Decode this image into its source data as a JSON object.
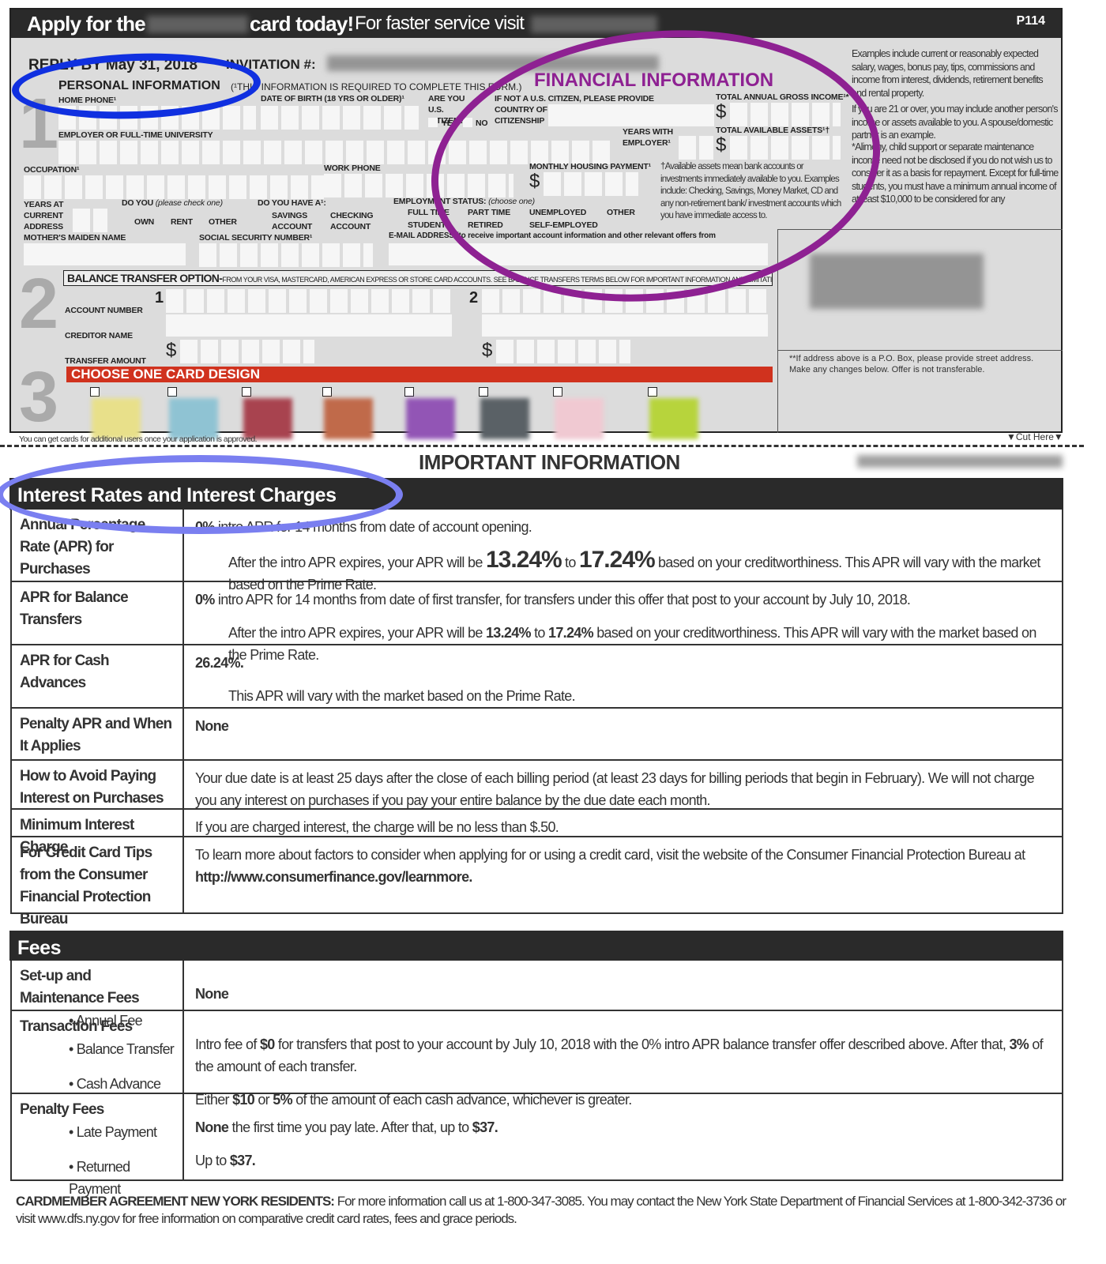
{
  "header": {
    "apply": "Apply for the",
    "card_today": "card today!",
    "faster": "For faster service visit",
    "code": "P114"
  },
  "top": {
    "reply_by": "REPLY BY May 31, 2018",
    "invitation": "INVITATION #:"
  },
  "section1": {
    "number": "1",
    "title": "PERSONAL INFORMATION",
    "title_note": "(¹THIS INFORMATION IS REQUIRED TO COMPLETE THIS FORM.)",
    "home_phone": "HOME PHONE¹",
    "dob": "DATE OF BIRTH (18 YRS OR OLDER)¹",
    "citizen": "ARE YOU U.S. CITIZEN?",
    "yes": "YES",
    "no": "NO",
    "not_citizen": "IF NOT A U.S. CITIZEN, PLEASE PROVIDE",
    "country": "COUNTRY OF CITIZENSHIP",
    "employer": "EMPLOYER OR FULL-TIME UNIVERSITY",
    "years_employer": "YEARS WITH EMPLOYER¹",
    "occupation": "OCCUPATION¹",
    "work_phone": "WORK PHONE",
    "housing": "MONTHLY HOUSING PAYMENT¹",
    "years_address": "YEARS AT CURRENT ADDRESS",
    "do_you": "DO YOU",
    "check_one": "(please check one)",
    "own": "OWN",
    "rent": "RENT",
    "other": "OTHER",
    "have_a": "DO YOU HAVE A¹:",
    "savings": "SAVINGS ACCOUNT",
    "checking": "CHECKING ACCOUNT",
    "employment": "EMPLOYMENT STATUS:",
    "choose_one": "(choose one)",
    "full_time": "FULL TIME",
    "part_time": "PART TIME",
    "unemployed": "UNEMPLOYED",
    "emp_other": "OTHER",
    "student": "STUDENT",
    "retired": "RETIRED",
    "self_employed": "SELF-EMPLOYED",
    "maiden": "MOTHER'S MAIDEN NAME",
    "ssn": "SOCIAL SECURITY NUMBER¹",
    "email": "E-MAIL ADDRESS (to receive important account information and other relevant offers from",
    "income": "TOTAL ANNUAL GROSS INCOME¹*",
    "assets": "TOTAL AVAILABLE ASSETS¹†",
    "financial_info": "FINANCIAL INFORMATION",
    "assets_note": "†Available assets mean bank accounts or investments immediately available to you. Examples include: Checking, Savings, Money Market, CD and any non-retirement bank/ investment accounts which you have immediate access to.",
    "income_note_1": "Examples include current or reasonably expected salary, wages, bonus pay, tips, commissions and income from interest, dividends, retirement benefits and rental property.",
    "income_note_2": "If you are 21 or over, you may include another person's income or assets available to you. A spouse/domestic partner is an example.",
    "income_note_3": "*Alimony, child support or separate maintenance income need not be disclosed if you do not wish us to consider it as a basis for repayment. Except for full-time students, you must have a minimum annual income of at least $10,000 to be considered for any"
  },
  "section2": {
    "number": "2",
    "title": "BALANCE TRANSFER OPTION-",
    "subtitle": "FROM YOUR VISA, MASTERCARD, AMERICAN EXPRESS OR STORE CARD ACCOUNTS. SEE BALANCE TRANSFERS TERMS BELOW FOR IMPORTANT INFORMATION AND LIMITATIONS.",
    "account_number": "ACCOUNT NUMBER",
    "creditor": "CREDITOR NAME",
    "amount": "TRANSFER AMOUNT",
    "one": "1",
    "two": "2",
    "dollar": "$"
  },
  "section3": {
    "number": "3",
    "title": "CHOOSE ONE CARD DESIGN",
    "swatches": [
      "#e8e08a",
      "#8fc3d3",
      "#a8434f",
      "#c06a4a",
      "#9255b5",
      "#5a6166",
      "#f0c9d2",
      "#b7d43c"
    ]
  },
  "address_note": "**If address above is a P.O. Box, please provide street address. Make any changes below. Offer is not transferable.",
  "additional_users": "You can get cards for additional users once your application is approved.",
  "cut_here": "▼Cut Here▼",
  "important": "IMPORTANT INFORMATION",
  "interest": {
    "title": "Interest Rates and Interest Charges",
    "rows": [
      {
        "label": [
          "Annual Percentage Rate (APR) for Purchases"
        ],
        "lines": [
          [
            {
              "b": "0%"
            },
            {
              "t": " intro APR for 14 months from date of account opening."
            }
          ],
          [
            {
              "t": "After the intro APR expires, your APR will be "
            },
            {
              "xl": "13.24%"
            },
            {
              "t": " to "
            },
            {
              "xl": "17.24%"
            },
            {
              "t": " based on your creditworthiness. This APR will vary with the market based on the Prime Rate."
            }
          ]
        ]
      },
      {
        "label": [
          "APR for Balance Transfers"
        ],
        "lines": [
          [
            {
              "b": "0%"
            },
            {
              "t": " intro APR for 14 months from date of first transfer, for transfers under this offer that post to your account by July 10, 2018."
            }
          ],
          [
            {
              "t": "After the intro APR expires, your APR will be "
            },
            {
              "b": "13.24%"
            },
            {
              "t": " to "
            },
            {
              "b": "17.24%"
            },
            {
              "t": " based on your creditworthiness. This APR will vary with the market based on the Prime Rate."
            }
          ]
        ]
      },
      {
        "label": [
          "APR for Cash Advances"
        ],
        "lines": [
          [
            {
              "b": "26.24%."
            }
          ],
          [
            {
              "t": "This APR will vary with the market based on the Prime Rate."
            }
          ]
        ]
      },
      {
        "label": [
          "Penalty APR and When It Applies"
        ],
        "lines": [
          [
            {
              "b": "None"
            }
          ]
        ]
      },
      {
        "label": [
          "How to Avoid Paying Interest on Purchases"
        ],
        "lines": [
          [
            {
              "t": "Your due date is at least 25 days after the close of each billing period (at least 23 days for billing periods that begin in February). We will not charge you any interest on purchases if you pay your entire balance by the due date each month."
            }
          ]
        ]
      },
      {
        "label": [
          "Minimum Interest Charge"
        ],
        "lines": [
          [
            {
              "t": "If you are charged interest, the charge will be no less than $.50."
            }
          ]
        ]
      },
      {
        "label": [
          "For Credit Card Tips from the Consumer Financial Protection Bureau"
        ],
        "lines": [
          [
            {
              "t": "To learn more about factors to consider when applying for or using a credit card, visit the website of the Consumer Financial Protection Bureau at "
            },
            {
              "b": "http://www.consumerfinance.gov/learnmore."
            }
          ]
        ]
      }
    ]
  },
  "fees": {
    "title": "Fees",
    "rows": [
      {
        "label": [
          "Set-up and Maintenance Fees"
        ],
        "subs": [
          "• Annual Fee"
        ],
        "lines": [
          [
            {
              "b": "None"
            }
          ]
        ]
      },
      {
        "label": [
          "Transaction Fees"
        ],
        "subs": [
          "• Balance Transfer",
          "• Cash Advance"
        ],
        "lines": [
          [
            {
              "t": "Intro fee of "
            },
            {
              "b": "$0"
            },
            {
              "t": " for transfers that post to your account by July 10, 2018 with the 0% intro APR balance transfer offer described above. After that, "
            },
            {
              "b": "3%"
            },
            {
              "t": " of the amount of each transfer."
            }
          ],
          [
            {
              "t": "Either "
            },
            {
              "b": "$10"
            },
            {
              "t": " or "
            },
            {
              "b": "5%"
            },
            {
              "t": " of the amount of each cash advance, whichever is greater."
            }
          ]
        ]
      },
      {
        "label": [
          "Penalty Fees"
        ],
        "subs": [
          "• Late Payment",
          "• Returned Payment"
        ],
        "lines": [
          [
            {
              "b": "None"
            },
            {
              "t": " the first time you pay late. After that, up to "
            },
            {
              "b": "$37."
            }
          ],
          [
            {
              "t": "Up to "
            },
            {
              "b": "$37."
            }
          ]
        ]
      }
    ]
  },
  "footer": {
    "bold": "CARDMEMBER AGREEMENT NEW YORK RESIDENTS:",
    "text": " For more information call us at 1-800-347-3085. You may contact the New York State Department of Financial Services at 1-800-342-3736 or visit www.dfs.ny.gov for free information on comparative credit card rates, fees and grace periods."
  },
  "colors": {
    "highlight_blue": "#1030e0",
    "highlight_purple": "#8e2192",
    "highlight_lavender": "#7a7ff0",
    "card_design_bar": "#d0321e"
  }
}
